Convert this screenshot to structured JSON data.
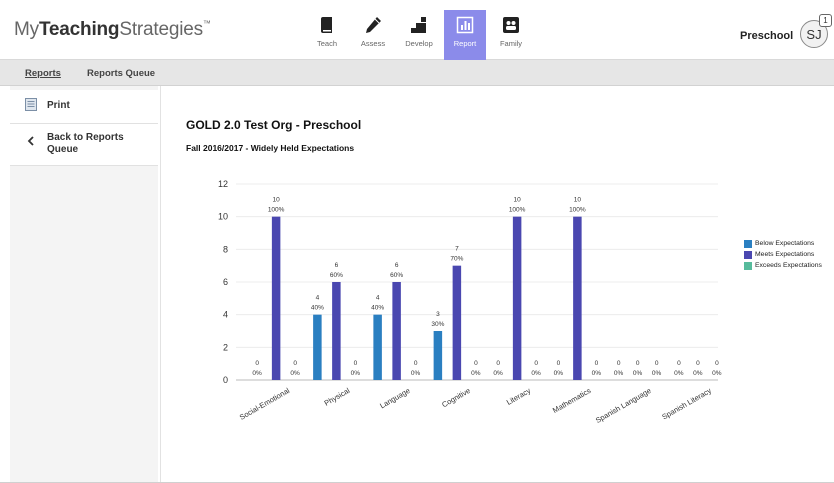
{
  "header": {
    "logo": {
      "prefix": "My",
      "bold": "Teaching",
      "suffix": "Strategies",
      "tm": "™"
    },
    "nav": [
      {
        "label": "Teach",
        "icon": "book-icon"
      },
      {
        "label": "Assess",
        "icon": "pencil-icon"
      },
      {
        "label": "Develop",
        "icon": "blocks-icon"
      },
      {
        "label": "Report",
        "icon": "bar-chart-icon"
      },
      {
        "label": "Family",
        "icon": "family-icon"
      }
    ],
    "active_nav": "Report",
    "context": "Preschool",
    "avatar": "SJ",
    "notification_count": "1"
  },
  "subnav": {
    "reports": "Reports",
    "reports_queue": "Reports Queue"
  },
  "sidebar": {
    "print": "Print",
    "back": "Back to Reports Queue"
  },
  "report": {
    "title": "GOLD 2.0 Test Org - Preschool",
    "subtitle": "Fall 2016/2017 - Widely Held Expectations"
  },
  "colors": {
    "below": "#2a7fc1",
    "meets": "#4a47b0",
    "exceeds": "#57bb9c",
    "active_nav": "#8b8bea"
  },
  "chart_data": {
    "type": "bar",
    "categories": [
      "Social-Emotional",
      "Physical",
      "Language",
      "Cognitive",
      "Literacy",
      "Mathematics",
      "Spanish Language",
      "Spanish Literacy"
    ],
    "series": [
      {
        "name": "Below Expectations",
        "values": [
          0,
          4,
          4,
          3,
          0,
          0,
          0,
          0
        ],
        "labels": [
          "0%",
          "40%",
          "40%",
          "30%",
          "0%",
          "0%",
          "0%",
          "0%"
        ]
      },
      {
        "name": "Meets Expectations",
        "values": [
          10,
          6,
          6,
          7,
          10,
          10,
          0,
          0
        ],
        "labels": [
          "100%",
          "60%",
          "60%",
          "70%",
          "100%",
          "100%",
          "0%",
          "0%"
        ]
      },
      {
        "name": "Exceeds Expectations",
        "values": [
          0,
          0,
          0,
          0,
          0,
          0,
          0,
          0
        ],
        "labels": [
          "0%",
          "0%",
          "0%",
          "0%",
          "0%",
          "0%",
          "0%",
          "0%"
        ]
      }
    ],
    "ylim": [
      0,
      12
    ],
    "yticks": [
      0,
      2,
      4,
      6,
      8,
      10,
      12
    ],
    "grid": true,
    "legend": "right"
  }
}
